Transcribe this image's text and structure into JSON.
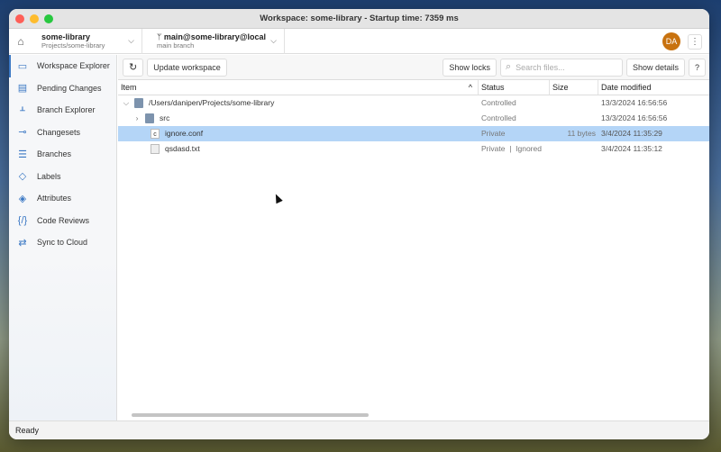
{
  "window": {
    "title": "Workspace: some-library - Startup time: 7359 ms"
  },
  "header": {
    "workspace": {
      "name": "some-library",
      "path": "Projects/some-library"
    },
    "branch": {
      "name": "main@some-library@local",
      "desc": "main branch"
    },
    "avatar": "DA"
  },
  "sidebar": {
    "items": [
      {
        "label": "Workspace Explorer",
        "icon": "folder-icon",
        "active": true
      },
      {
        "label": "Pending Changes",
        "icon": "pending-changes-icon"
      },
      {
        "label": "Branch Explorer",
        "icon": "branch-explorer-icon"
      },
      {
        "label": "Changesets",
        "icon": "changesets-icon"
      },
      {
        "label": "Branches",
        "icon": "branches-icon"
      },
      {
        "label": "Labels",
        "icon": "label-icon"
      },
      {
        "label": "Attributes",
        "icon": "attributes-icon"
      },
      {
        "label": "Code Reviews",
        "icon": "code-review-icon"
      },
      {
        "label": "Sync to Cloud",
        "icon": "sync-icon"
      }
    ]
  },
  "toolbar": {
    "update": "Update workspace",
    "show_locks": "Show locks",
    "search_placeholder": "Search files...",
    "show_details": "Show details",
    "help": "?"
  },
  "table": {
    "columns": [
      "Item",
      "Status",
      "Size",
      "Date modified"
    ],
    "rows": [
      {
        "name": "/Users/danipen/Projects/some-library",
        "status": "Controlled",
        "size": "",
        "date": "13/3/2024 16:56:56"
      },
      {
        "name": "src",
        "status": "Controlled",
        "size": "",
        "date": "13/3/2024 16:56:56"
      },
      {
        "name": "ignore.conf",
        "status": "Private",
        "size": "11 bytes",
        "date": "3/4/2024 11:35:29"
      },
      {
        "name": "qsdasd.txt",
        "status": "Private",
        "status2": "Ignored",
        "size": "",
        "date": "3/4/2024 11:35:12"
      }
    ]
  },
  "statusbar": {
    "text": "Ready"
  },
  "colors": {
    "accent": "#3b78c4",
    "selection": "#b4d5f7",
    "avatar": "#c8720f"
  }
}
